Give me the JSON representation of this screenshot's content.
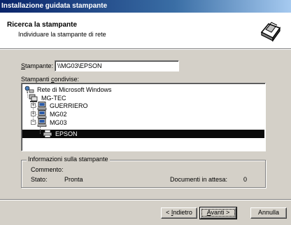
{
  "window": {
    "title": "Installazione guidata stampante"
  },
  "header": {
    "title": "Ricerca la stampante",
    "subtitle": "Individuare la stampante di rete",
    "icon": "printer-wizard-icon"
  },
  "printer_field": {
    "label_accel": "S",
    "label_rest": "tampante:",
    "value": "\\\\MG03\\EPSON"
  },
  "shared": {
    "label_prefix": "Stampanti ",
    "label_accel": "c",
    "label_rest": "ondivise:"
  },
  "tree": [
    {
      "label": "Rete di Microsoft Windows",
      "icon": "network-icon"
    },
    {
      "label": "MG-TEC",
      "icon": "workgroup-icon"
    },
    {
      "label": "GUERRIERO",
      "icon": "computer-icon",
      "expander": "+"
    },
    {
      "label": "MG02",
      "icon": "computer-icon",
      "expander": "+"
    },
    {
      "label": "MG03",
      "icon": "computer-icon",
      "expander": "-"
    },
    {
      "label": "EPSON",
      "icon": "printer-icon",
      "selected": true
    }
  ],
  "info": {
    "group_title": "Informazioni sulla stampante",
    "comment_label": "Commento:",
    "status_label": "Stato:",
    "status_value": "Pronta",
    "queue_label": "Documenti in attesa:",
    "queue_value": "0"
  },
  "buttons": {
    "back_prefix": "< ",
    "back_accel": "I",
    "back_rest": "ndietro",
    "next_accel": "A",
    "next_rest": "vanti >",
    "cancel": "Annulla"
  },
  "colors": {
    "title_start": "#0a246a",
    "title_end": "#a6caf0",
    "face": "#d4d0c8",
    "selection": "#0a0a0a"
  }
}
